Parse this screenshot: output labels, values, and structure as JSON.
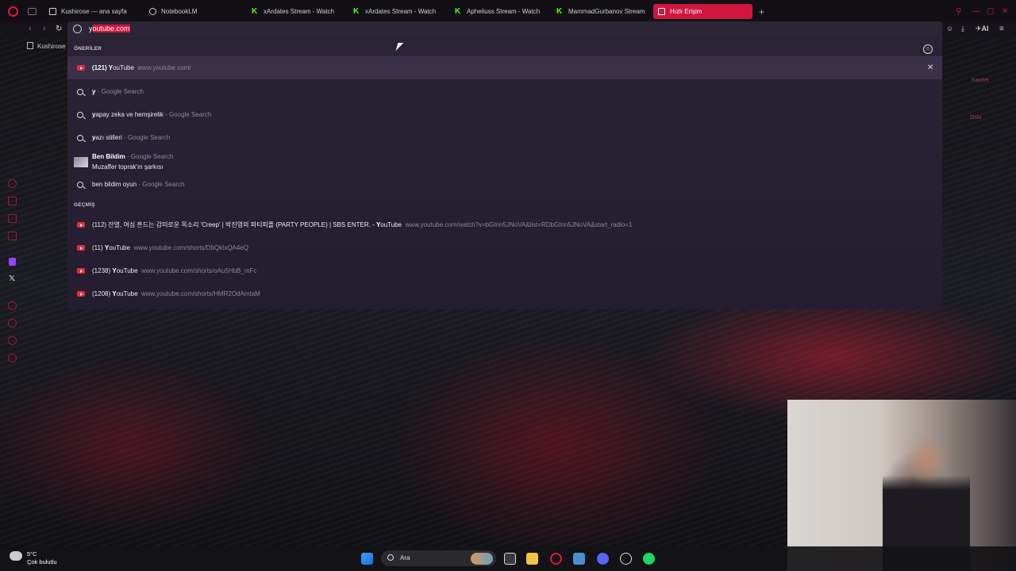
{
  "tabs": [
    {
      "label": "Kushirose — ana sayfa",
      "favicon": "twitch"
    },
    {
      "label": "NotebookLM",
      "favicon": "notebooklm"
    },
    {
      "label": "xArdates Stream - Watch",
      "favicon": "kick"
    },
    {
      "label": "xArdates Stream - Watch",
      "favicon": "kick"
    },
    {
      "label": "Apheliuss Stream - Watch",
      "favicon": "kick"
    },
    {
      "label": "MammadGurbanov Stream",
      "favicon": "kick"
    },
    {
      "label": "Hızlı Erişim",
      "favicon": "speed-dial",
      "active": true
    }
  ],
  "address": {
    "typed": "y",
    "autocomplete": "outube.com"
  },
  "toolbar": {
    "ai_label": "AI"
  },
  "bookmarks": [
    {
      "label": "Kushirose"
    }
  ],
  "speed_dial_ghost": {
    "item1": "Kaydet",
    "item2": "Oslo"
  },
  "dropdown": {
    "suggestions_label": "ÖNERİLER",
    "history_label": "GEÇMİŞ",
    "suggestions": [
      {
        "type": "site",
        "bold": "(121) Y",
        "text": "ouTube",
        "url": "www.youtube.com/",
        "highlighted": true
      },
      {
        "type": "search",
        "bold": "y",
        "text": "",
        "sub": "- Google Search"
      },
      {
        "type": "search",
        "bold": "y",
        "text": "apay zeka ve hemşirelik",
        "sub": "- Google Search"
      },
      {
        "type": "search",
        "bold": "y",
        "text": "azı stilleri",
        "sub": "- Google Search"
      },
      {
        "type": "rich",
        "bold": "Ben Bildim",
        "sub": "- Google Search",
        "line2": "Muzaffer toprak'ın şarkısı"
      },
      {
        "type": "search",
        "bold": "",
        "text": "ben bildim oyun",
        "sub": "- Google Search"
      }
    ],
    "history": [
      {
        "text": "(112) 잔열, 여심 흔드는 감미로운 목소리 'Creep' | 박진영의 파티피플 (PARTY PEOPLE) | SBS ENTER. - ",
        "bold": "Y",
        "text2": "ouTube",
        "url": "www.youtube.com/watch?v=bGInn5JNoVA&list=RDbGInn5JNoVA&start_radio=1"
      },
      {
        "text": "(11) ",
        "bold": "Y",
        "text2": "ouTube",
        "url": "www.youtube.com/shorts/DbQkIxQA4eQ"
      },
      {
        "text": "(1238) ",
        "bold": "Y",
        "text2": "ouTube",
        "url": "www.youtube.com/shorts/oAu5HbB_mFc"
      },
      {
        "text": "(1208) ",
        "bold": "Y",
        "text2": "ouTube",
        "url": "www.youtube.com/shorts/HMR2OdAmtaM"
      }
    ]
  },
  "taskbar": {
    "temperature": "5°C",
    "weather": "Çok bulutlu",
    "search_placeholder": "Ara"
  },
  "colors": {
    "accent": "#d0163e",
    "dropdown_bg": "#2a2336"
  }
}
